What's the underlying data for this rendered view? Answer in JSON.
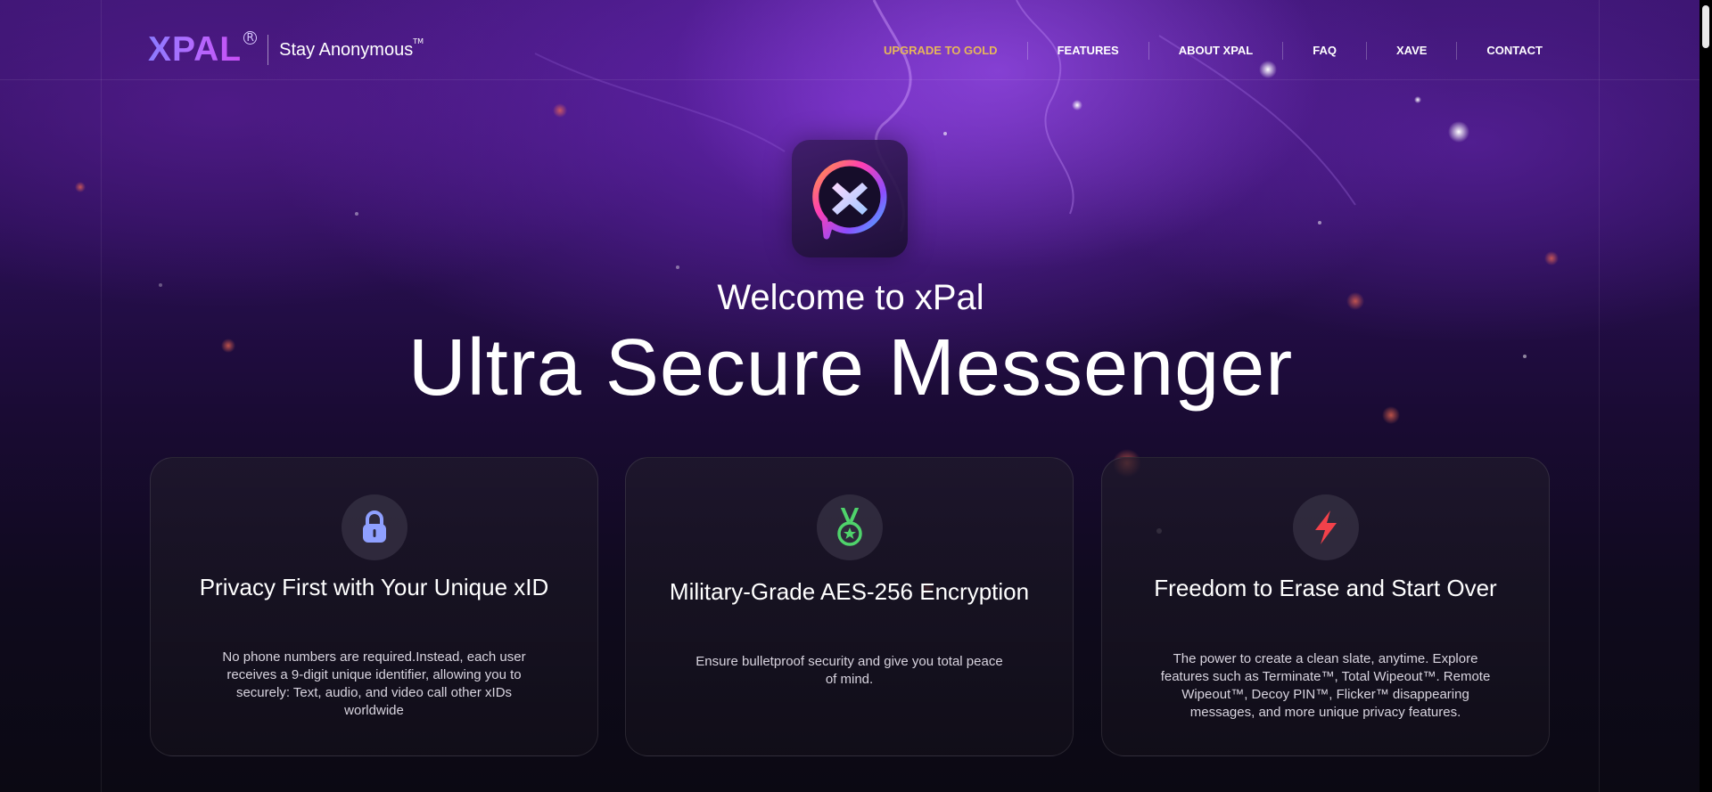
{
  "brand": {
    "logo_text": "XPAL",
    "registered_mark": "R",
    "tagline": "Stay Anonymous",
    "trademark": "TM"
  },
  "nav": {
    "items": [
      {
        "label": "UPGRADE TO GOLD",
        "highlight": true
      },
      {
        "label": "FEATURES"
      },
      {
        "label": "ABOUT XPAL"
      },
      {
        "label": "FAQ"
      },
      {
        "label": "XAVE"
      },
      {
        "label": "CONTACT"
      }
    ]
  },
  "hero": {
    "app_icon": "xpal-app-icon",
    "welcome": "Welcome to xPal",
    "title": "Ultra Secure Messenger"
  },
  "features": [
    {
      "icon": "lock-icon",
      "icon_color": "#8fa0ff",
      "title": "Privacy First with Your Unique xID",
      "description": "No phone numbers are required.Instead, each user receives a 9-digit unique identifier, allowing you to securely: Text, audio, and video call other xIDs worldwide"
    },
    {
      "icon": "medal-icon",
      "icon_color": "#4fd36b",
      "title": "Military-Grade AES-256 Encryption",
      "description": "Ensure bulletproof security and give you total peace of mind."
    },
    {
      "icon": "lightning-icon",
      "icon_color": "#f2414a",
      "title": "Freedom to Erase and Start Over",
      "description": "The power to create a clean slate, anytime. Explore features such as Terminate™, Total Wipeout™. Remote Wipeout™, Decoy PIN™, Flicker™ disappearing messages, and more unique privacy features."
    }
  ],
  "colors": {
    "gold_accent": "#e6b65a",
    "background_top": "#3b1570",
    "background_bottom": "#0b0913"
  }
}
